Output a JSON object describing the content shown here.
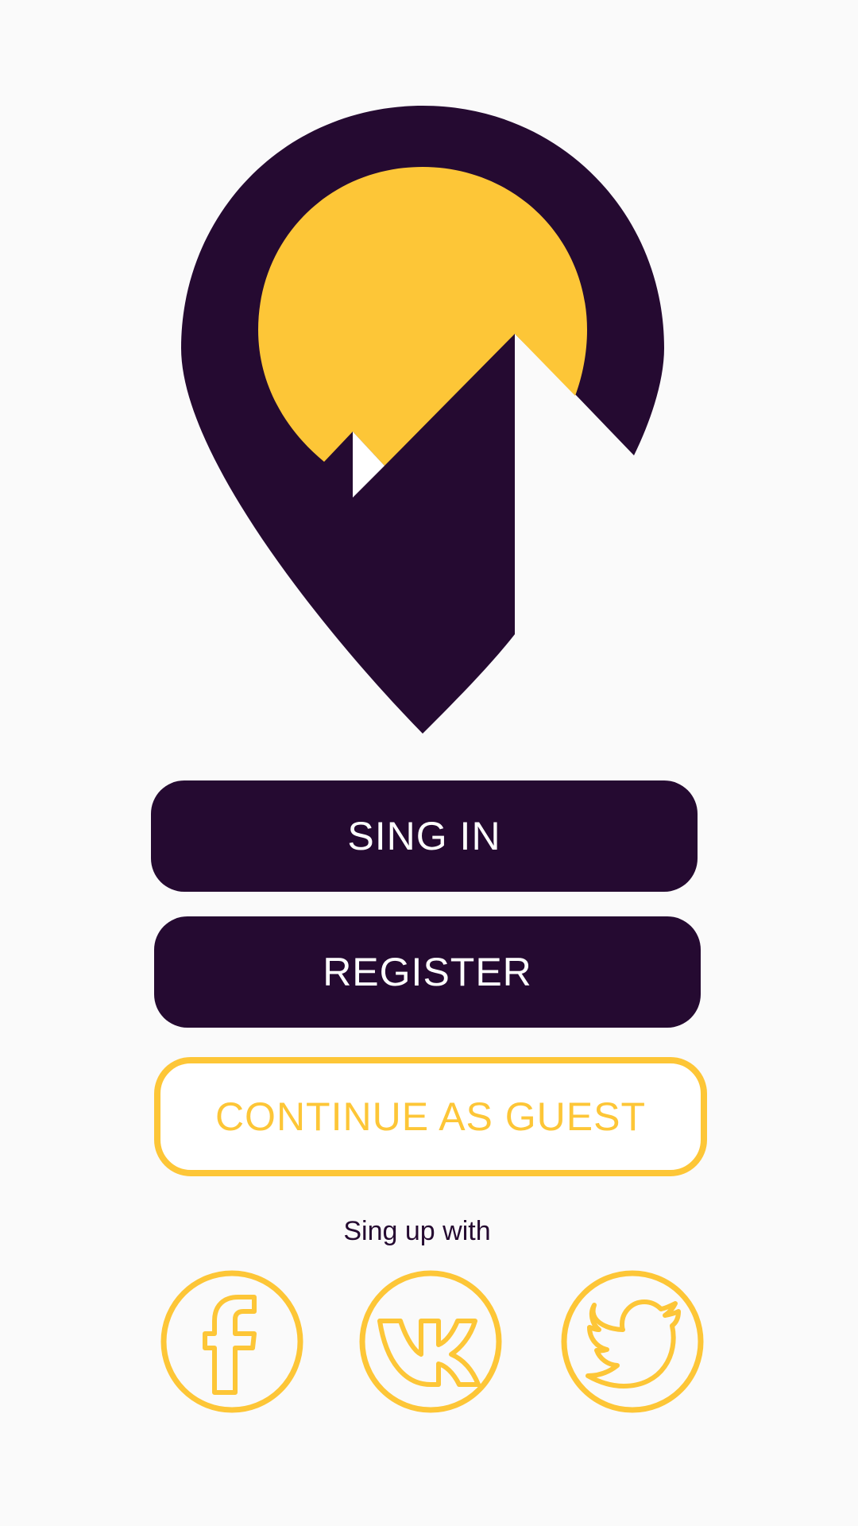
{
  "colors": {
    "primary": "#250a31",
    "accent": "#fdc637",
    "background": "#fafafa"
  },
  "logo": {
    "icon": "map-pin-mountain-sun-logo"
  },
  "buttons": {
    "sign_in": "SING IN",
    "register": "REGISTER",
    "guest": "CONTINUE AS GUEST"
  },
  "signup": {
    "label": "Sing up with",
    "providers": [
      {
        "icon": "facebook-icon"
      },
      {
        "icon": "vk-icon"
      },
      {
        "icon": "twitter-icon"
      }
    ]
  }
}
